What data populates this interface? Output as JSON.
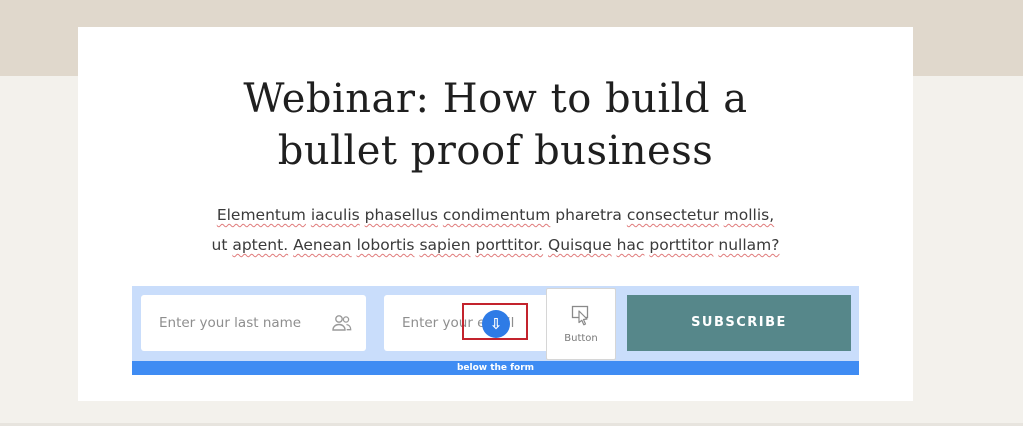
{
  "hero": {
    "title_line1": "Webinar: How to build a",
    "title_line2": "bullet proof business",
    "description": [
      "Elementum",
      "iaculis",
      "phasellus",
      "condimentum",
      "pharetra",
      "consectetur",
      "mollis,",
      "ut",
      "aptent.",
      "Aenean",
      "lobortis",
      "sapien",
      "porttitor.",
      "Quisque",
      "hac",
      "porttitor",
      "nullam?"
    ]
  },
  "form": {
    "last_name_placeholder": "Enter your last name",
    "email_placeholder_visible": "Enter your email",
    "button_widget_label": "Button",
    "subscribe_label": "SUBSCRIBE",
    "footer_label": "below the form"
  },
  "colors": {
    "subscribe_bg": "#56878a",
    "selection_band": "#c9ddfb",
    "footer_bar": "#3f8cf3",
    "drop_indicator": "#c3232d"
  }
}
